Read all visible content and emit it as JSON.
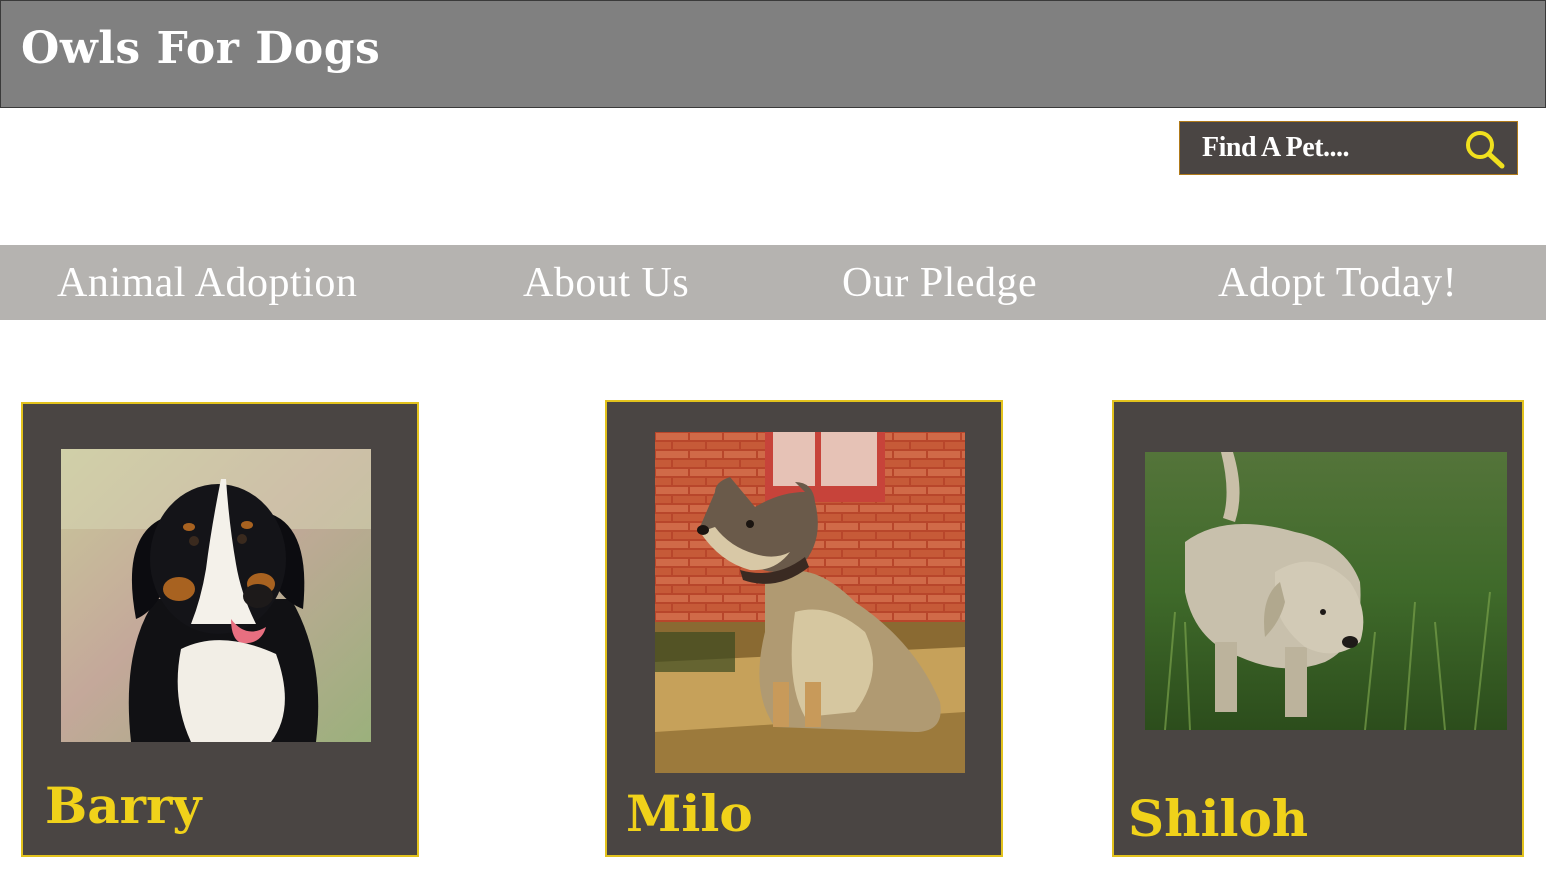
{
  "header": {
    "title": "Owls For Dogs"
  },
  "search": {
    "placeholder": "Find A Pet....",
    "icon": "magnifying-glass",
    "icon_color": "#f0e01e"
  },
  "nav": {
    "items": [
      {
        "label": "Animal Adoption"
      },
      {
        "label": "About Us"
      },
      {
        "label": "Our Pledge"
      },
      {
        "label": "Adopt Today!"
      }
    ]
  },
  "pets": [
    {
      "name": "Barry",
      "photo": "bernese-mountain-dog-portrait"
    },
    {
      "name": "Milo",
      "photo": "cattle-dog-by-brick-wall"
    },
    {
      "name": "Shiloh",
      "photo": "shaggy-dog-in-grass"
    }
  ],
  "colors": {
    "header_bg": "#808080",
    "nav_bg": "#b5b3b0",
    "card_bg": "#4a4543",
    "card_border": "#e2c21d",
    "accent_yellow": "#f0d21a"
  }
}
